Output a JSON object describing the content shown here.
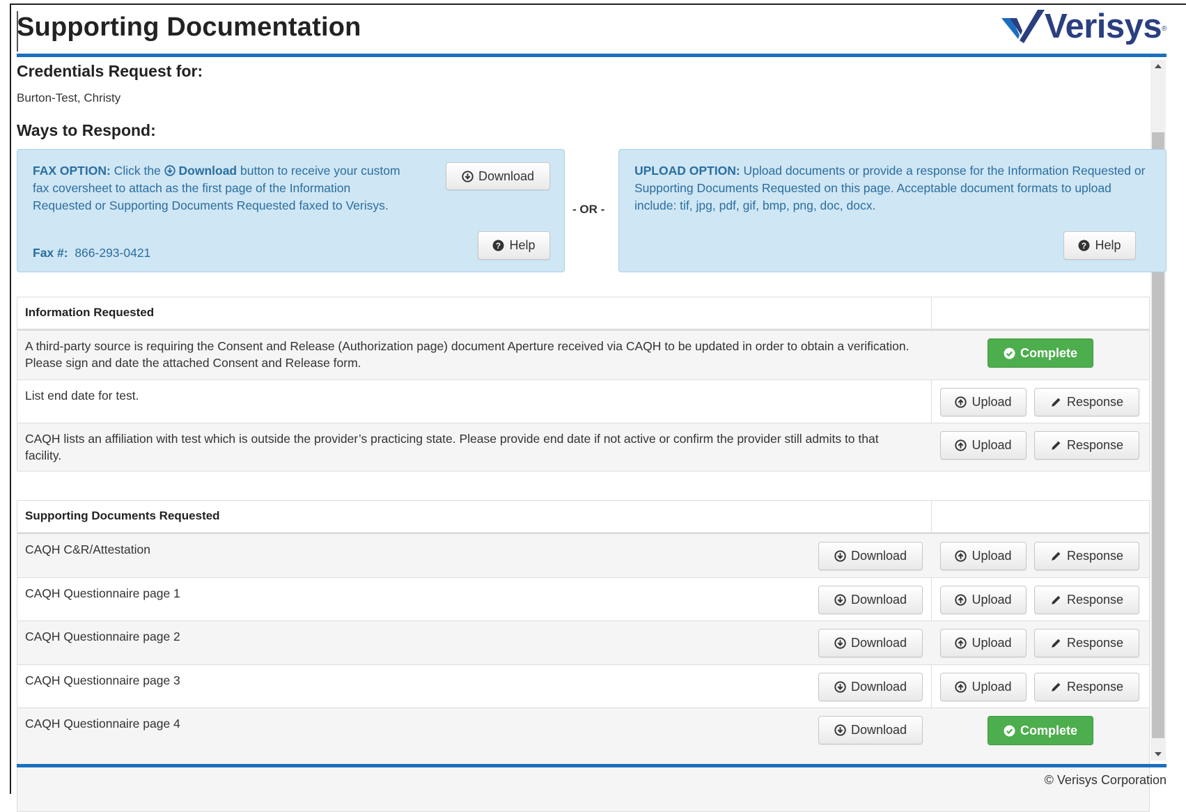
{
  "header": {
    "title": "Supporting Documentation",
    "logo_text": "Verisys",
    "logo_tm": "®"
  },
  "credentials": {
    "heading": "Credentials Request for:",
    "name": "Burton-Test, Christy"
  },
  "ways": {
    "heading": "Ways to Respond:",
    "or_label": "- OR -"
  },
  "fax": {
    "label": "FAX OPTION:",
    "text_before": " Click the ",
    "download_word": "Download",
    "text_after": " button to receive your custom fax coversheet to attach as the first page of the Information Requested or Supporting Documents Requested faxed to Verisys.",
    "fax_label": "Fax #:",
    "fax_number": "866-293-0421",
    "download_btn": "Download",
    "help_btn": "Help"
  },
  "upload": {
    "label": "UPLOAD OPTION:",
    "text": " Upload documents or provide a response for the Information Requested or Supporting Documents Requested on this page.  Acceptable document formats to upload include:  tif, jpg, pdf, gif, bmp, png, doc, docx.",
    "help_btn": "Help"
  },
  "info_requested": {
    "heading": "Information Requested",
    "rows": [
      {
        "text": "A third-party source is requiring the Consent and Release (Authorization page) document Aperture received via CAQH to be updated in order to obtain a verification.  Please sign and date the attached Consent and Release form.",
        "status": "Complete"
      },
      {
        "text": "List end date for test.",
        "upload": "Upload",
        "response": "Response"
      },
      {
        "text": "CAQH lists an affiliation with test which is outside the provider’s practicing state.  Please provide end date if not active or confirm the provider still admits to that facility.",
        "upload": "Upload",
        "response": "Response"
      }
    ]
  },
  "supporting_docs": {
    "heading": "Supporting Documents Requested",
    "rows": [
      {
        "text": "CAQH C&R/Attestation",
        "download": "Download",
        "upload": "Upload",
        "response": "Response"
      },
      {
        "text": "CAQH Questionnaire page 1",
        "download": "Download",
        "upload": "Upload",
        "response": "Response"
      },
      {
        "text": "CAQH Questionnaire page 2",
        "download": "Download",
        "upload": "Upload",
        "response": "Response"
      },
      {
        "text": "CAQH Questionnaire page 3",
        "download": "Download",
        "upload": "Upload",
        "response": "Response"
      },
      {
        "text": "CAQH Questionnaire page 4",
        "download": "Download",
        "status": "Complete"
      }
    ]
  },
  "footer": {
    "copyright": "© Verisys Corporation"
  },
  "colors": {
    "accent_blue": "#1b6fbd",
    "well_bg": "#cfe6f4",
    "well_text": "#2b6ea0",
    "complete_green": "#4cae4c",
    "logo_navy": "#2a3f80"
  }
}
